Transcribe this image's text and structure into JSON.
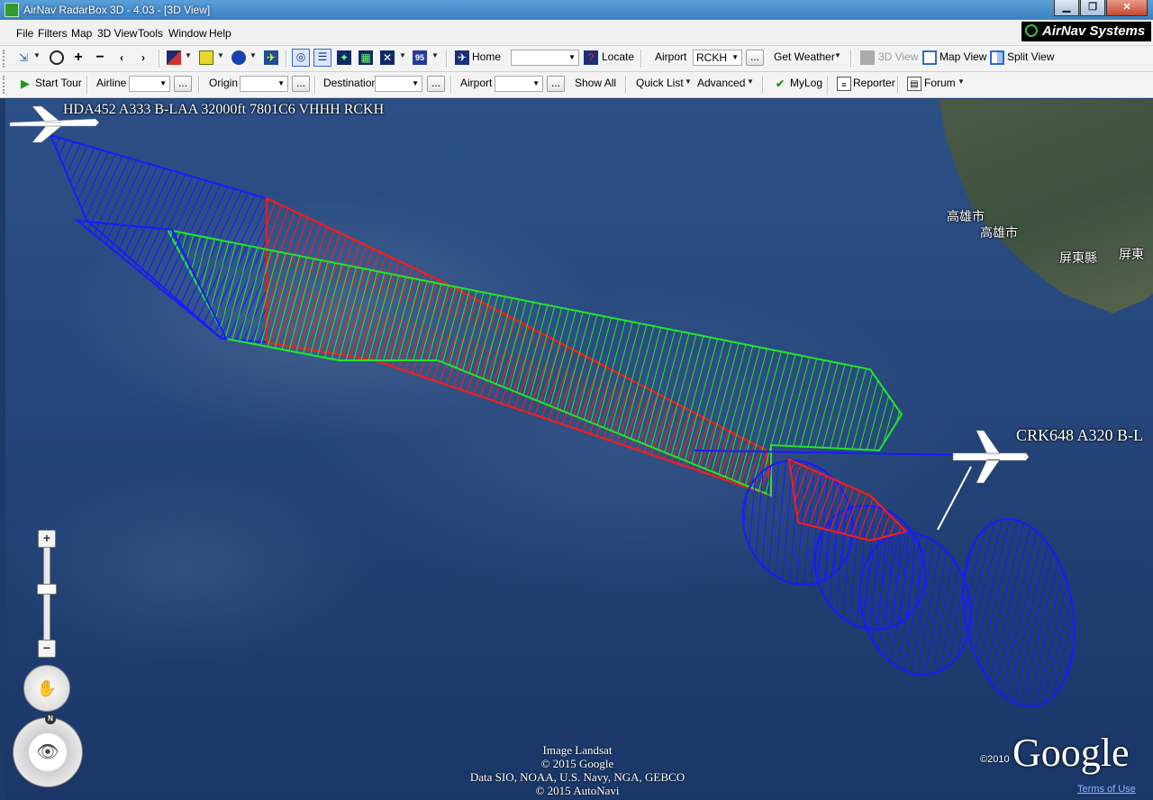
{
  "window": {
    "title": "AirNav RadarBox 3D - 4.03  - [3D View]"
  },
  "menu": [
    "File",
    "Filters",
    "Map",
    "3D View",
    "Tools",
    "Window",
    "Help"
  ],
  "brand": {
    "name": "AirNav Systems"
  },
  "toolbar1": {
    "home_label": "Home",
    "locate_label": "Locate",
    "airport_label": "Airport",
    "airport_value": "RCKH",
    "get_weather_label": "Get Weather",
    "view3d_label": "3D View",
    "map_view_label": "Map View",
    "split_view_label": "Split View",
    "locate_value": ""
  },
  "toolbar2": {
    "start_tour_label": "Start Tour",
    "airline_label": "Airline",
    "origin_label": "Origin",
    "destination_label": "Destination",
    "airport_label": "Airport",
    "show_all_label": "Show All",
    "quick_list_label": "Quick List",
    "advanced_label": "Advanced",
    "mylog_label": "MyLog",
    "reporter_label": "Reporter",
    "forum_label": "Forum",
    "ellipsis": "..."
  },
  "map": {
    "flights": [
      {
        "label": "HDA452 A333 B-LAA 32000ft 7801C6 VHHH RCKH"
      },
      {
        "label": "CRK648 A320 B-L"
      }
    ],
    "places": [
      "高雄市",
      "高雄市",
      "屏東縣",
      "屏東"
    ],
    "attribution": [
      "Image Landsat",
      "© 2015 Google",
      "Data SIO, NOAA, U.S. Navy, NGA, GEBCO",
      "© 2015 AutoNavi"
    ],
    "provider": "Google",
    "provider_year": "©2010",
    "terms": "Terms of Use",
    "north_label": "N"
  },
  "colors": {
    "track_blue": "#1a1aff",
    "track_green": "#22ee22",
    "track_red": "#ff1a1a"
  }
}
